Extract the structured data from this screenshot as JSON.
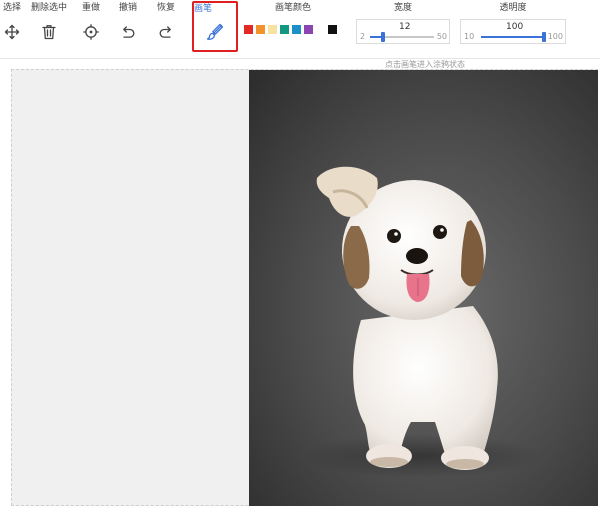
{
  "toolbar": {
    "select_label": "选择",
    "delete_selected_label": "删除选中",
    "redo_label": "重做",
    "undo_label": "撤销",
    "restore_label": "恢复",
    "brush_label": "画笔",
    "brush_color_label": "画笔颜色",
    "brush_colors": [
      "#e02a23",
      "#f2922c",
      "#f7e2a2",
      "#12987e",
      "#1c8fc6",
      "#8b44b0",
      "#ffffff",
      "#111111"
    ],
    "width": {
      "label": "宽度",
      "value": "12",
      "min": "2",
      "max": "50",
      "fraction": 0.21
    },
    "opacity": {
      "label": "透明度",
      "value": "100",
      "min": "10",
      "max": "100",
      "fraction": 1.0
    },
    "accent_color": "#3a72d8",
    "highlight_color": "#e02020"
  },
  "canvas": {
    "hint": "点击画笔进入涂鸦状态",
    "background_color": "#f0f0f0"
  },
  "photo": {
    "subject": "dog-photo"
  }
}
